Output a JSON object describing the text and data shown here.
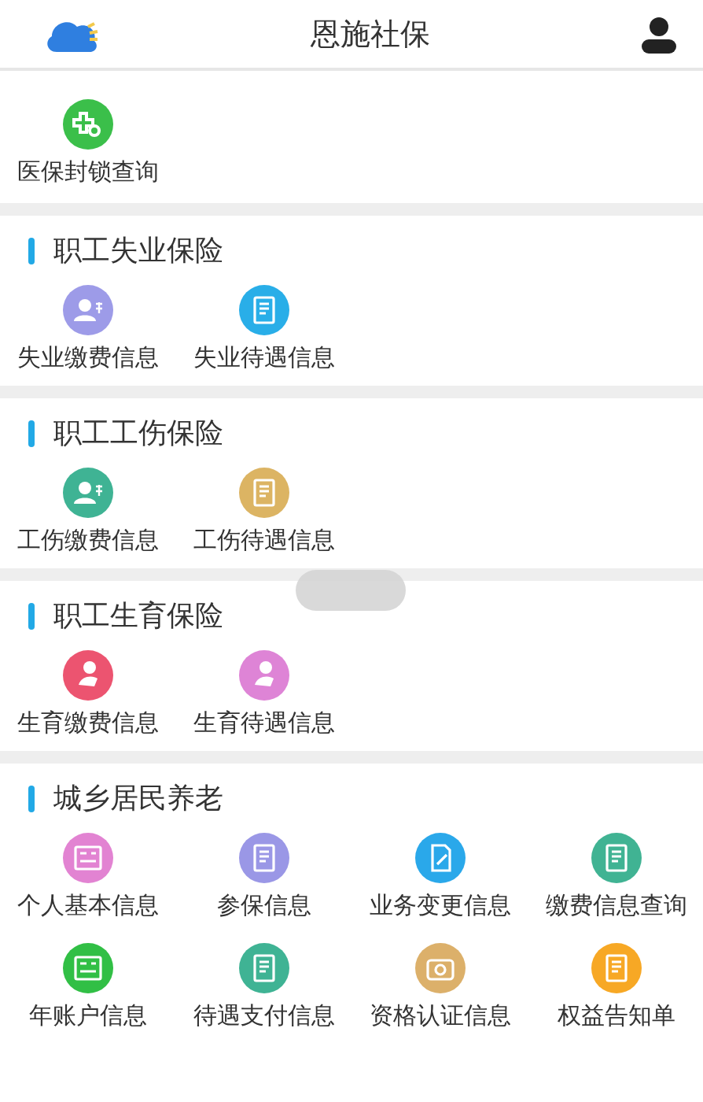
{
  "header": {
    "title": "恩施社保"
  },
  "top_items": [
    {
      "label": "医保封锁查询",
      "color": "#3bbf4a",
      "kind": "search"
    }
  ],
  "sections": [
    {
      "title": "职工失业保险",
      "items": [
        {
          "label": "失业缴费信息",
          "color": "#9d9be8",
          "kind": "person"
        },
        {
          "label": "失业待遇信息",
          "color": "#29aee8",
          "kind": "doc"
        }
      ]
    },
    {
      "title": "职工工伤保险",
      "items": [
        {
          "label": "工伤缴费信息",
          "color": "#3fb394",
          "kind": "person"
        },
        {
          "label": "工伤待遇信息",
          "color": "#dcb463",
          "kind": "doc"
        }
      ]
    },
    {
      "title": "职工生育保险",
      "items": [
        {
          "label": "生育缴费信息",
          "color": "#ec5470",
          "kind": "baby"
        },
        {
          "label": "生育待遇信息",
          "color": "#de84d6",
          "kind": "baby"
        }
      ]
    },
    {
      "title": "城乡居民养老",
      "items": [
        {
          "label": "个人基本信息",
          "color": "#e283d2",
          "kind": "card"
        },
        {
          "label": "参保信息",
          "color": "#9a97e6",
          "kind": "doc"
        },
        {
          "label": "业务变更信息",
          "color": "#2aa8ea",
          "kind": "edit"
        },
        {
          "label": "缴费信息查询",
          "color": "#40b393",
          "kind": "doc"
        },
        {
          "label": "年账户信息",
          "color": "#31bf45",
          "kind": "card"
        },
        {
          "label": "待遇支付信息",
          "color": "#3fb394",
          "kind": "doc"
        },
        {
          "label": "资格认证信息",
          "color": "#dcb06a",
          "kind": "camera"
        },
        {
          "label": "权益告知单",
          "color": "#f7a825",
          "kind": "doc"
        }
      ]
    }
  ]
}
